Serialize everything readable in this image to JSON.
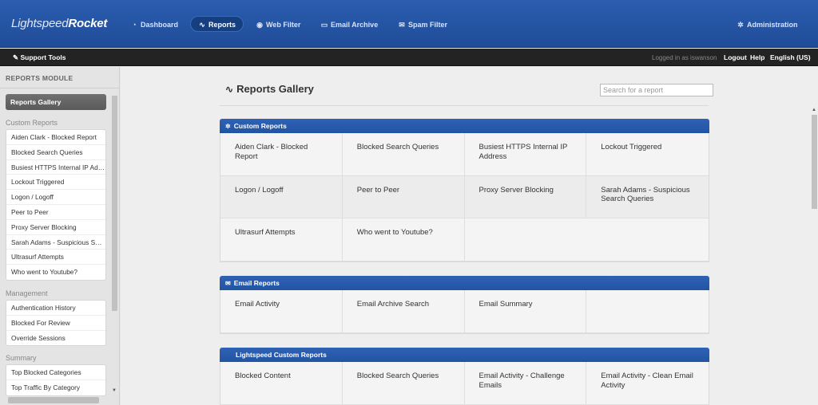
{
  "topnav": {
    "logo_light": "Lightspeed",
    "logo_bold": "Rocket",
    "items": [
      {
        "label": "Dashboard",
        "icon": "dashboard-icon"
      },
      {
        "label": "Reports",
        "icon": "reports-icon",
        "active": true
      },
      {
        "label": "Web Filter",
        "icon": "web-filter-icon"
      },
      {
        "label": "Email Archive",
        "icon": "email-archive-icon"
      },
      {
        "label": "Spam Filter",
        "icon": "spam-filter-icon"
      }
    ],
    "admin": {
      "label": "Administration",
      "icon": "gear-icon"
    }
  },
  "subbar": {
    "tools_label": "Support Tools",
    "logged_in": "Logged in as iswanson",
    "logout": "Logout",
    "help": "Help",
    "language": "English (US)"
  },
  "sidebar": {
    "module_title": "REPORTS MODULE",
    "gallery_label": "Reports Gallery",
    "sections": [
      {
        "title": "Custom Reports",
        "items": [
          "Aiden Clark - Blocked Report",
          "Blocked Search Queries",
          "Busiest HTTPS Internal IP Address",
          "Lockout Triggered",
          "Logon / Logoff",
          "Peer to Peer",
          "Proxy Server Blocking",
          "Sarah Adams - Suspicious Search Queries",
          "Ultrasurf Attempts",
          "Who went to Youtube?"
        ]
      },
      {
        "title": "Management",
        "items": [
          "Authentication History",
          "Blocked For Review",
          "Override Sessions"
        ]
      },
      {
        "title": "Summary",
        "items": [
          "Top Blocked Categories",
          "Top Traffic By Category"
        ]
      }
    ]
  },
  "main": {
    "title": "Reports Gallery",
    "search_placeholder": "Search for a report",
    "panels": [
      {
        "title": "Custom Reports",
        "icon": "gear-icon",
        "cells": [
          "Aiden Clark - Blocked Report",
          "Blocked Search Queries",
          "Busiest HTTPS Internal IP Address",
          "Lockout Triggered",
          "Logon / Logoff",
          "Peer to Peer",
          "Proxy Server Blocking",
          "Sarah Adams - Suspicious Search Queries",
          "Ultrasurf Attempts",
          "Who went to Youtube?",
          ""
        ]
      },
      {
        "title": "Email Reports",
        "icon": "envelope-icon",
        "cells": [
          "Email Activity",
          "Email Archive Search",
          "Email Summary",
          ""
        ]
      },
      {
        "title": "Lightspeed Custom Reports",
        "icon": "",
        "cells": [
          "Blocked Content",
          "Blocked Search Queries",
          "Email Activity - Challenge Emails",
          "Email Activity - Clean Email Activity"
        ]
      }
    ]
  },
  "colors": {
    "nav_blue": "#2455a6",
    "panel_blue": "#2559ad",
    "subbar_dark": "#232323"
  }
}
